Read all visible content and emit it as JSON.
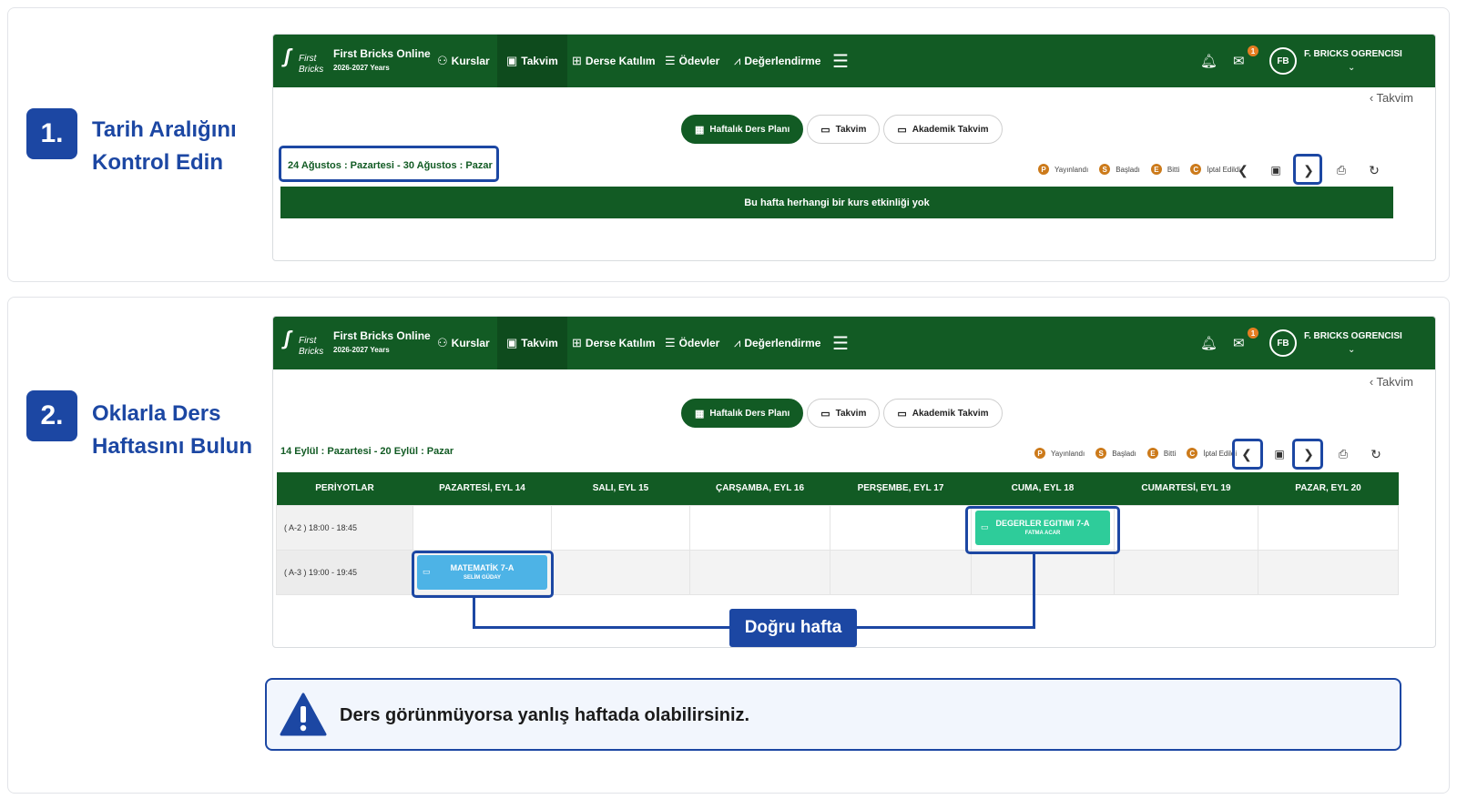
{
  "nav": {
    "logo_line1": "First",
    "logo_line2": "Bricks",
    "brand_title": "First Bricks Online",
    "brand_sub": "2026-2027 Years",
    "items": [
      {
        "label": "Kurslar",
        "icon": "book-icon"
      },
      {
        "label": "Takvim",
        "icon": "calendar-icon"
      },
      {
        "label": "Derse Katılım",
        "icon": "classroom-icon"
      },
      {
        "label": "Ödevler",
        "icon": "checklist-icon"
      },
      {
        "label": "Değerlendirme",
        "icon": "chart-icon"
      }
    ],
    "mail_badge": "1",
    "avatar": "FB",
    "user": "F. BRICKS OGRENCISI"
  },
  "breadcrumb": "Takvim",
  "tabs": [
    {
      "label": "Haftalık Ders Planı",
      "active": true
    },
    {
      "label": "Takvim",
      "active": false
    },
    {
      "label": "Akademik Takvim",
      "active": false
    }
  ],
  "legend": [
    {
      "chip": "P",
      "label": "Yayınlandı"
    },
    {
      "chip": "S",
      "label": "Başladı"
    },
    {
      "chip": "E",
      "label": "Bitti"
    },
    {
      "chip": "C",
      "label": "İptal Edildi"
    }
  ],
  "step1": {
    "number": "1.",
    "title": "Tarih Aralığını Kontrol Edin",
    "date_range": "24 Ağustos : Pazartesi - 30 Ağustos : Pazar",
    "empty_message": "Bu hafta herhangi bir kurs etkinliği yok"
  },
  "step2": {
    "number": "2.",
    "title": "Oklarla Ders Haftasını Bulun",
    "date_range": "14 Eylül : Pazartesi - 20 Eylül : Pazar",
    "table": {
      "headers": [
        "PERİYOTLAR",
        "PAZARTESİ, EYL 14",
        "SALI, EYL 15",
        "ÇARŞAMBA, EYL 16",
        "PERŞEMBE, EYL 17",
        "CUMA, EYL 18",
        "CUMARTESİ, EYL 19",
        "PAZAR, EYL 20"
      ],
      "periods": [
        "( A-2 ) 18:00 - 18:45",
        "( A-3 ) 19:00 - 19:45"
      ],
      "events": [
        {
          "name": "DEGERLER EGITIMI 7-A",
          "teacher": "FATMA ACAR",
          "day": "CUMA, EYL 18",
          "period": "( A-2 ) 18:00 - 18:45",
          "color": "#2ecc9a"
        },
        {
          "name": "MATEMATİK 7-A",
          "teacher": "SELİM GÜDAY",
          "day": "PAZARTESİ, EYL 14",
          "period": "( A-3 ) 19:00 - 19:45",
          "color": "#4db3e6"
        }
      ]
    },
    "callout": "Doğru hafta"
  },
  "warning": "Ders görünmüyorsa yanlış haftada olabilirsiniz.",
  "colors": {
    "brand_green": "#125b24",
    "accent_blue": "#1c47a3",
    "legend_chip": "#cc7a1a"
  }
}
